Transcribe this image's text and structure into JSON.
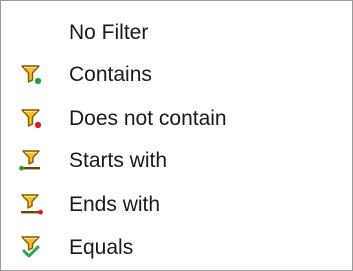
{
  "menu": {
    "items": [
      {
        "label": "No Filter",
        "icon": ""
      },
      {
        "label": "Contains",
        "icon": "filter-contains-icon"
      },
      {
        "label": "Does not contain",
        "icon": "filter-does-not-contain-icon"
      },
      {
        "label": "Starts with",
        "icon": "filter-starts-with-icon"
      },
      {
        "label": "Ends with",
        "icon": "filter-ends-with-icon"
      },
      {
        "label": "Equals",
        "icon": "filter-equals-icon"
      }
    ]
  },
  "colors": {
    "funnel_fill": "#f2c12e",
    "funnel_stroke": "#8a5a00",
    "dot_green": "#1fa33a",
    "dot_red": "#d42020",
    "check_green": "#2aa84a"
  }
}
